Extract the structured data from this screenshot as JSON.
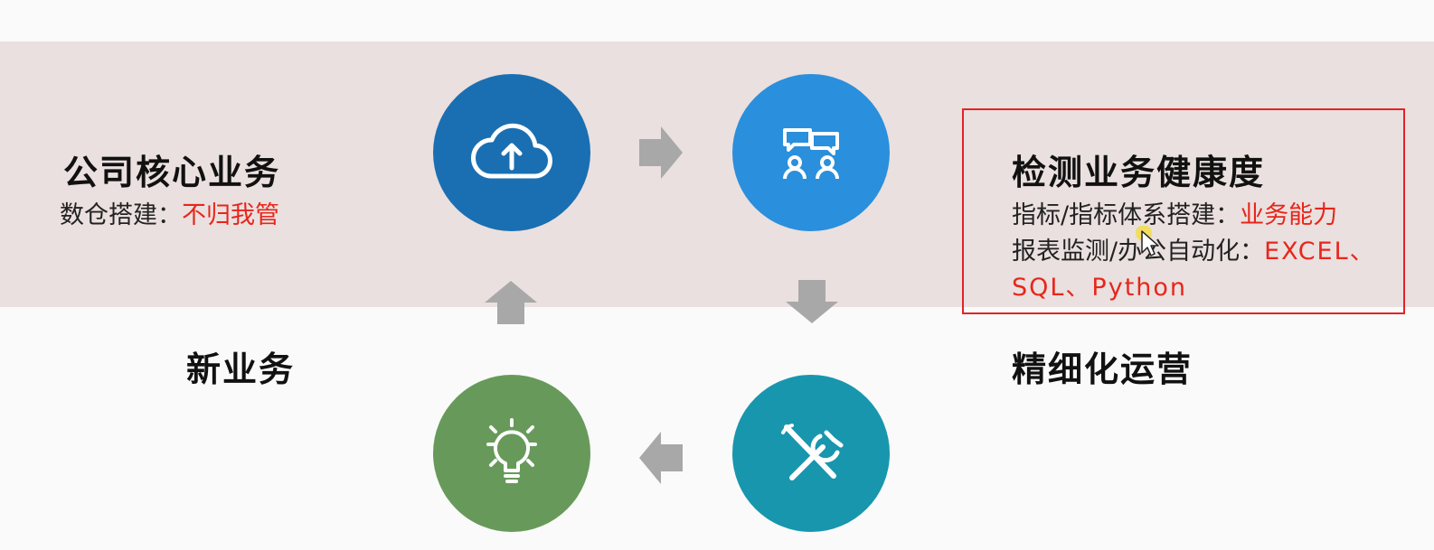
{
  "left_block": {
    "title": "公司核心业务",
    "line1_prefix": "数仓搭建：",
    "line1_highlight": "不归我管"
  },
  "new_business": {
    "title": "新业务"
  },
  "right_block": {
    "title": "检测业务健康度",
    "line1_prefix": "指标/指标体系搭建：",
    "line1_highlight": "业务能力",
    "line2_prefix": "报表监测/办公自动化：",
    "line2_highlight": "EXCEL、",
    "line3_highlight": "SQL、Python"
  },
  "refined_ops": {
    "title": "精细化运营"
  },
  "icons": {
    "top_left": "cloud-upload-icon",
    "top_right": "chat-people-icon",
    "bottom_left": "lightbulb-icon",
    "bottom_right": "tools-icon"
  },
  "colors": {
    "band": "#eae0df",
    "circle_top_left": "#1a6fb2",
    "circle_top_right": "#2a8fdc",
    "circle_bottom_left": "#679a5a",
    "circle_bottom_right": "#1896ae",
    "arrow": "#a8a8a8",
    "highlight_text": "#e8261b",
    "highlight_box": "#e32327"
  }
}
